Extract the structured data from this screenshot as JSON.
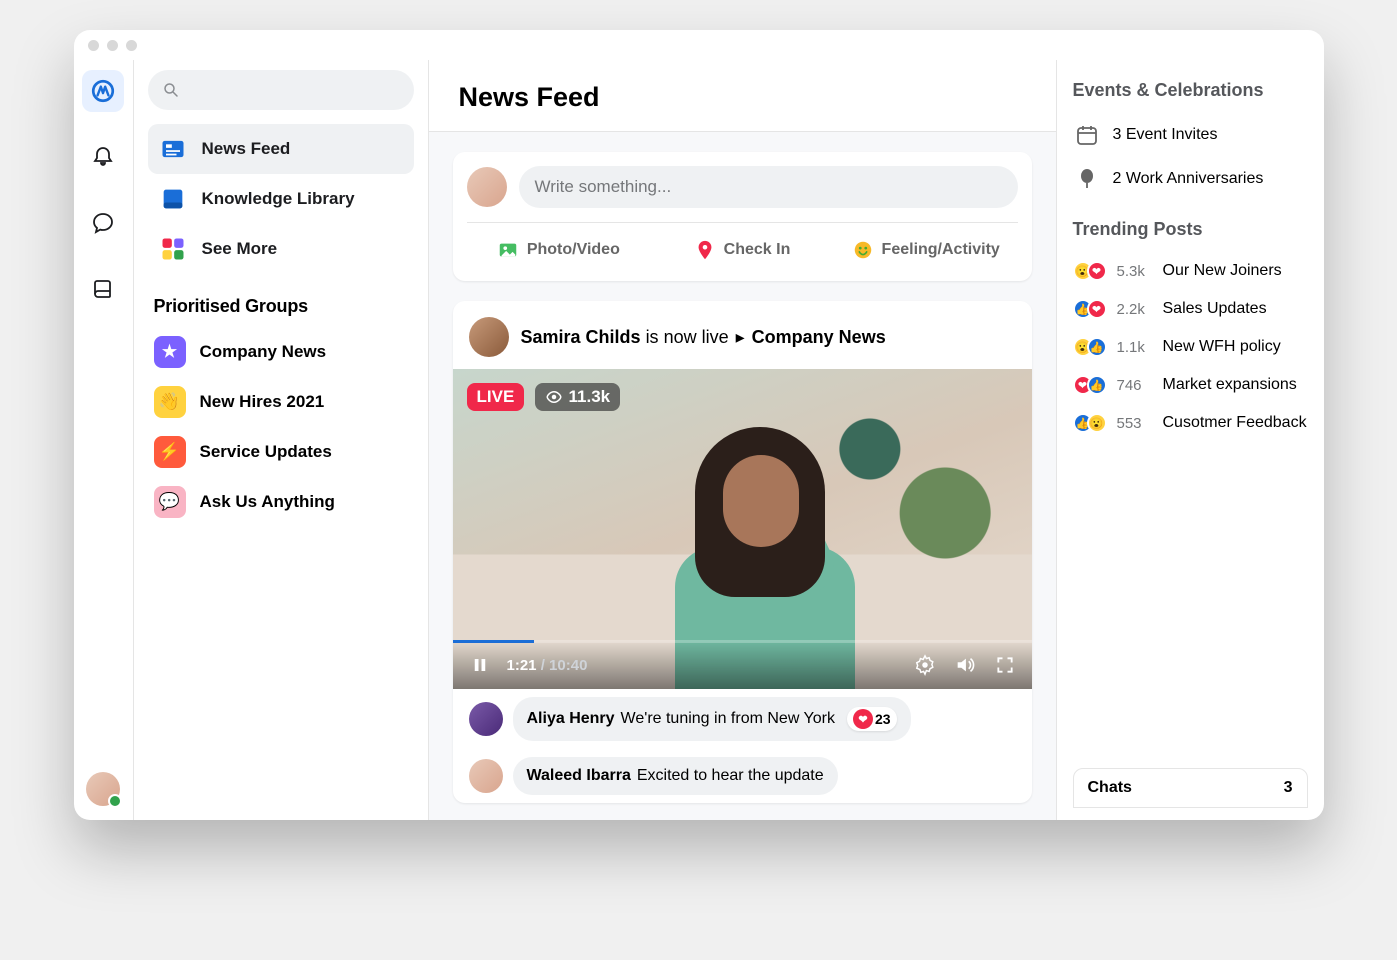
{
  "page_title": "News Feed",
  "search": {
    "placeholder": ""
  },
  "nav": {
    "items": [
      {
        "label": "News Feed"
      },
      {
        "label": "Knowledge Library"
      },
      {
        "label": "See More"
      }
    ],
    "groups_heading": "Prioritised Groups",
    "groups": [
      {
        "label": "Company News"
      },
      {
        "label": "New Hires 2021"
      },
      {
        "label": "Service Updates"
      },
      {
        "label": "Ask Us Anything"
      }
    ]
  },
  "composer": {
    "placeholder": "Write something...",
    "actions": [
      {
        "label": "Photo/Video"
      },
      {
        "label": "Check In"
      },
      {
        "label": "Feeling/Activity"
      }
    ]
  },
  "post": {
    "author": "Samira Childs",
    "verb": "is now live",
    "target": "Company News",
    "live_label": "LIVE",
    "viewers": "11.3k",
    "current_time": "1:21",
    "duration": "10:40"
  },
  "comments": [
    {
      "author": "Aliya Henry",
      "text": "We're tuning in from New York",
      "react_count": "23"
    },
    {
      "author": "Waleed Ibarra",
      "text": "Excited to hear the update"
    }
  ],
  "events": {
    "heading": "Events & Celebrations",
    "items": [
      {
        "label": "3 Event Invites"
      },
      {
        "label": "2 Work Anniversaries"
      }
    ]
  },
  "trending": {
    "heading": "Trending Posts",
    "items": [
      {
        "count": "5.3k",
        "title": "Our New Joiners"
      },
      {
        "count": "2.2k",
        "title": "Sales Updates"
      },
      {
        "count": "1.1k",
        "title": "New WFH policy"
      },
      {
        "count": "746",
        "title": "Market expansions"
      },
      {
        "count": "553",
        "title": "Cusotmer Feedback"
      }
    ]
  },
  "chats": {
    "label": "Chats",
    "count": "3"
  }
}
